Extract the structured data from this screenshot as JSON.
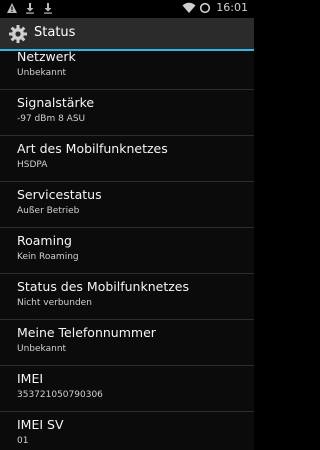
{
  "statusbar": {
    "time": "16:01",
    "icons": [
      "warning-icon",
      "download-icon",
      "download-icon",
      "wifi-icon",
      "sync-icon"
    ]
  },
  "actionbar": {
    "title": "Status",
    "accent": "#33b5e5",
    "icon": "gear-icon"
  },
  "items": [
    {
      "label": "Netzwerk",
      "value": "Unbekannt"
    },
    {
      "label": "Signalstärke",
      "value": "-97 dBm   8 ASU"
    },
    {
      "label": "Art des Mobilfunknetzes",
      "value": "HSDPA"
    },
    {
      "label": "Servicestatus",
      "value": "Außer Betrieb"
    },
    {
      "label": "Roaming",
      "value": "Kein Roaming"
    },
    {
      "label": "Status des Mobilfunknetzes",
      "value": "Nicht verbunden"
    },
    {
      "label": "Meine Telefonnummer",
      "value": "Unbekannt"
    },
    {
      "label": "IMEI",
      "value": "353721050790306"
    },
    {
      "label": "IMEI SV",
      "value": "01"
    }
  ]
}
